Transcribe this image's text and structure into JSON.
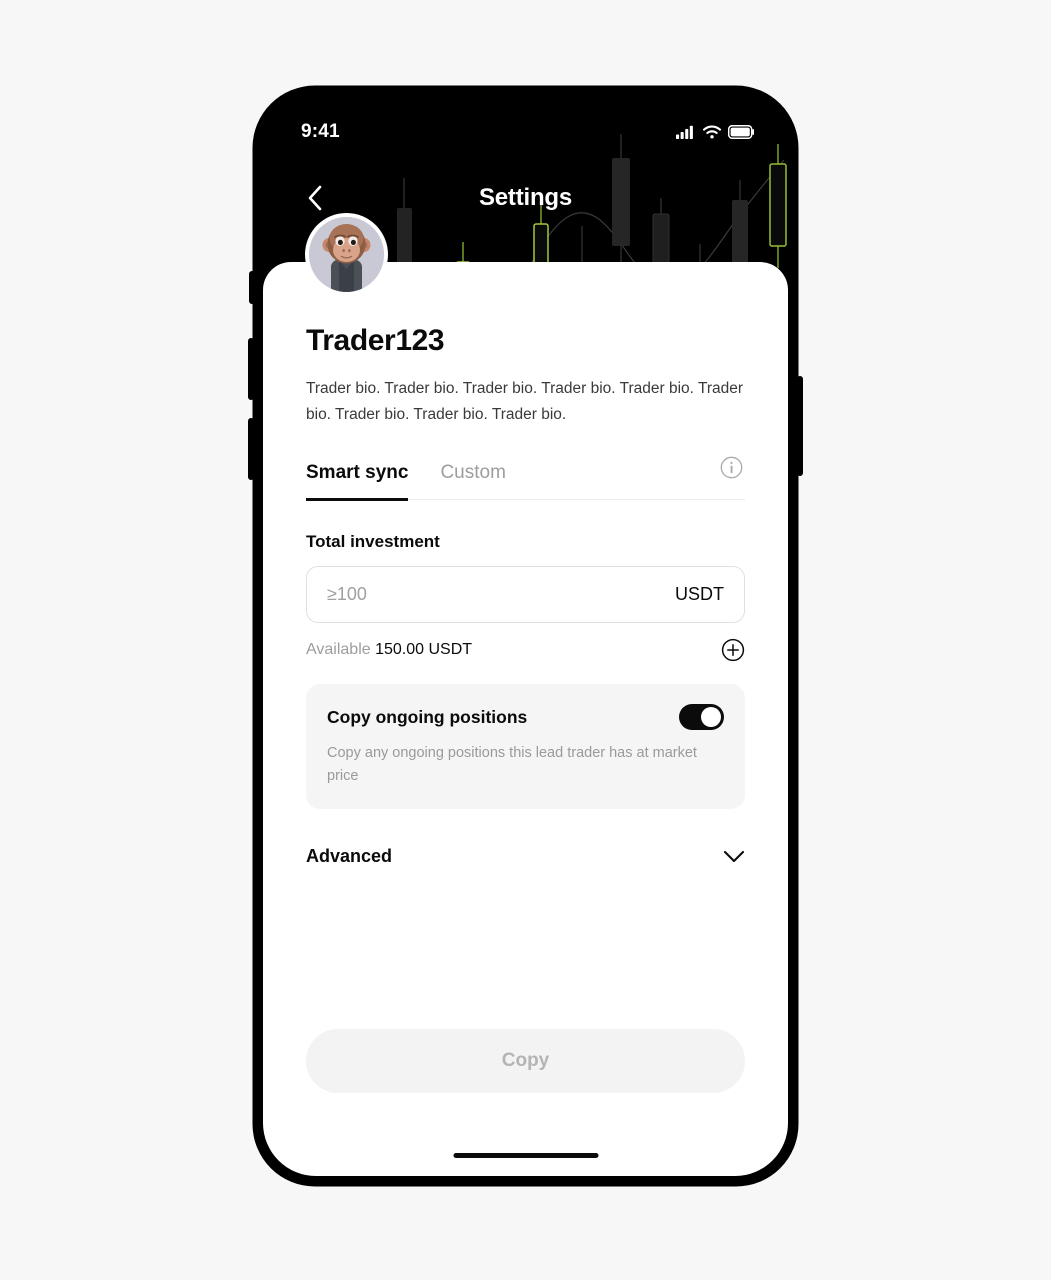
{
  "status_bar": {
    "time": "9:41",
    "icons": [
      "signal-bars-icon",
      "wifi-icon",
      "battery-icon"
    ]
  },
  "header": {
    "title": "Settings",
    "back_icon": "chevron-left-icon",
    "background_art": "candlestick-chart",
    "bg_color": "#000000",
    "candle_up_color": "#a3c93a",
    "candle_down_color": "#2b2b2b"
  },
  "profile": {
    "avatar_icon": "monkey-avatar",
    "username": "Trader123",
    "bio": "Trader bio. Trader bio. Trader bio. Trader bio. Trader bio. Trader bio. Trader bio. Trader bio. Trader bio."
  },
  "tabs": {
    "items": [
      {
        "label": "Smart sync",
        "active": true
      },
      {
        "label": "Custom",
        "active": false
      }
    ],
    "info_icon": "info-circle-icon"
  },
  "investment": {
    "label": "Total investment",
    "placeholder": "≥100",
    "value": "",
    "unit": "USDT",
    "available_label": "Available",
    "available_amount": "150.00 USDT",
    "add_icon": "plus-circle-icon"
  },
  "copy_positions": {
    "title": "Copy ongoing positions",
    "description": "Copy any ongoing positions this lead trader has at market price",
    "toggle_state": "on"
  },
  "advanced": {
    "label": "Advanced",
    "chevron_icon": "chevron-down-icon",
    "expanded": false
  },
  "footer": {
    "primary_button_label": "Copy",
    "primary_button_enabled": false
  },
  "colors": {
    "page_background": "#f7f7f7",
    "sheet": "#ffffff",
    "text_primary": "#0b0b0b",
    "text_muted": "#9d9d9d",
    "card": "#f5f5f5",
    "button_disabled_bg": "#f3f3f3",
    "button_disabled_text": "#b4b4b4"
  }
}
